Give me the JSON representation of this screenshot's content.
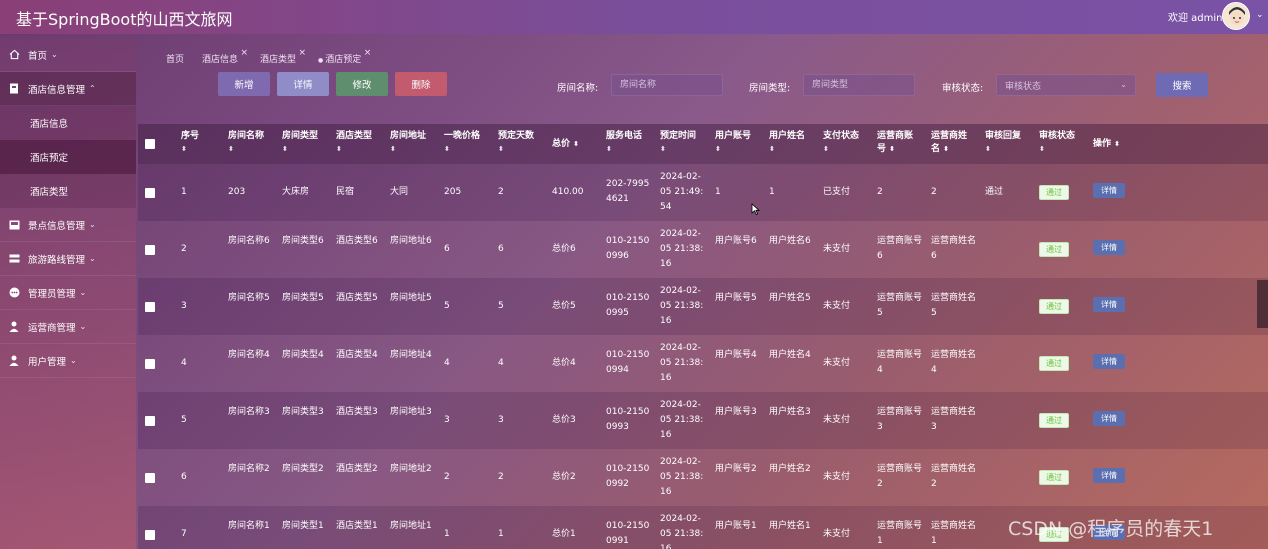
{
  "app": {
    "title": "基于SpringBoot的山西文旅网",
    "welcome": "欢迎 admin"
  },
  "sidebar": {
    "items": [
      {
        "label": "首页",
        "icon": "home-icon"
      },
      {
        "label": "酒店信息管理",
        "icon": "hotel-icon"
      },
      {
        "label": "景点信息管理",
        "icon": "scenic-icon"
      },
      {
        "label": "旅游路线管理",
        "icon": "route-icon"
      },
      {
        "label": "管理员管理",
        "icon": "admin-icon"
      },
      {
        "label": "运营商管理",
        "icon": "operator-icon"
      },
      {
        "label": "用户管理",
        "icon": "user-icon"
      }
    ],
    "subitems": [
      {
        "label": "酒店信息"
      },
      {
        "label": "酒店预定"
      },
      {
        "label": "酒店类型"
      }
    ]
  },
  "tabs": [
    {
      "label": "首页"
    },
    {
      "label": "酒店信息"
    },
    {
      "label": "酒店类型"
    },
    {
      "label": "酒店预定"
    }
  ],
  "toolbar": {
    "add": "新增",
    "detail": "详情",
    "edit": "修改",
    "delete": "删除"
  },
  "filters": {
    "room_name": {
      "label": "房间名称:",
      "placeholder": "房间名称"
    },
    "room_type": {
      "label": "房间类型:",
      "placeholder": "房间类型"
    },
    "audit_status": {
      "label": "审核状态:",
      "placeholder": "审核状态"
    },
    "search": "搜索"
  },
  "table": {
    "headers": [
      "序号",
      "房间名称",
      "房间类型",
      "酒店类型",
      "房间地址",
      "一晚价格",
      "预定天数",
      "总价",
      "服务电话",
      "预定时间",
      "用户账号",
      "用户姓名",
      "支付状态",
      "运营商账号",
      "运营商姓名",
      "审核回复",
      "审核状态",
      "操作"
    ],
    "rows": [
      {
        "no": "1",
        "room_name": "203",
        "room_type": "大床房",
        "hotel_type": "民宿",
        "address": "大同",
        "price": "205",
        "days": "2",
        "total": "410.00",
        "phone": "202-7995 4621",
        "time": "2024-02-05 21:49:54",
        "user_acc": "1",
        "user_name": "1",
        "pay": "已支付",
        "op_acc": "2",
        "op_name": "2",
        "reply": "通过",
        "status": "通过",
        "action": "详情"
      },
      {
        "no": "2",
        "room_name": "房间名称6",
        "room_type": "房间类型6",
        "hotel_type": "酒店类型6",
        "address": "房间地址6",
        "price": "6",
        "days": "6",
        "total": "总价6",
        "phone": "010-2150 0996",
        "time": "2024-02-05 21:38:16",
        "user_acc": "用户账号6",
        "user_name": "用户姓名6",
        "pay": "未支付",
        "op_acc": "运营商账号6",
        "op_name": "运营商姓名6",
        "reply": "",
        "status": "通过",
        "action": "详情"
      },
      {
        "no": "3",
        "room_name": "房间名称5",
        "room_type": "房间类型5",
        "hotel_type": "酒店类型5",
        "address": "房间地址5",
        "price": "5",
        "days": "5",
        "total": "总价5",
        "phone": "010-2150 0995",
        "time": "2024-02-05 21:38:16",
        "user_acc": "用户账号5",
        "user_name": "用户姓名5",
        "pay": "未支付",
        "op_acc": "运营商账号5",
        "op_name": "运营商姓名5",
        "reply": "",
        "status": "通过",
        "action": "详情"
      },
      {
        "no": "4",
        "room_name": "房间名称4",
        "room_type": "房间类型4",
        "hotel_type": "酒店类型4",
        "address": "房间地址4",
        "price": "4",
        "days": "4",
        "total": "总价4",
        "phone": "010-2150 0994",
        "time": "2024-02-05 21:38:16",
        "user_acc": "用户账号4",
        "user_name": "用户姓名4",
        "pay": "未支付",
        "op_acc": "运营商账号4",
        "op_name": "运营商姓名4",
        "reply": "",
        "status": "通过",
        "action": "详情"
      },
      {
        "no": "5",
        "room_name": "房间名称3",
        "room_type": "房间类型3",
        "hotel_type": "酒店类型3",
        "address": "房间地址3",
        "price": "3",
        "days": "3",
        "total": "总价3",
        "phone": "010-2150 0993",
        "time": "2024-02-05 21:38:16",
        "user_acc": "用户账号3",
        "user_name": "用户姓名3",
        "pay": "未支付",
        "op_acc": "运营商账号3",
        "op_name": "运营商姓名3",
        "reply": "",
        "status": "通过",
        "action": "详情"
      },
      {
        "no": "6",
        "room_name": "房间名称2",
        "room_type": "房间类型2",
        "hotel_type": "酒店类型2",
        "address": "房间地址2",
        "price": "2",
        "days": "2",
        "total": "总价2",
        "phone": "010-2150 0992",
        "time": "2024-02-05 21:38:16",
        "user_acc": "用户账号2",
        "user_name": "用户姓名2",
        "pay": "未支付",
        "op_acc": "运营商账号2",
        "op_name": "运营商姓名2",
        "reply": "",
        "status": "通过",
        "action": "详情"
      },
      {
        "no": "7",
        "room_name": "房间名称1",
        "room_type": "房间类型1",
        "hotel_type": "酒店类型1",
        "address": "房间地址1",
        "price": "1",
        "days": "1",
        "total": "总价1",
        "phone": "010-2150 0991",
        "time": "2024-02-05 21:38:16",
        "user_acc": "用户账号1",
        "user_name": "用户姓名1",
        "pay": "未支付",
        "op_acc": "运营商账号1",
        "op_name": "运营商姓名1",
        "reply": "",
        "status": "通过",
        "action": "详情"
      }
    ]
  },
  "watermark": "CSDN @程序员的春天1",
  "colors": {
    "approved_bg": "#eef8e8",
    "approved_text": "#67c23a",
    "detail_btn": "#5b6fb0"
  }
}
